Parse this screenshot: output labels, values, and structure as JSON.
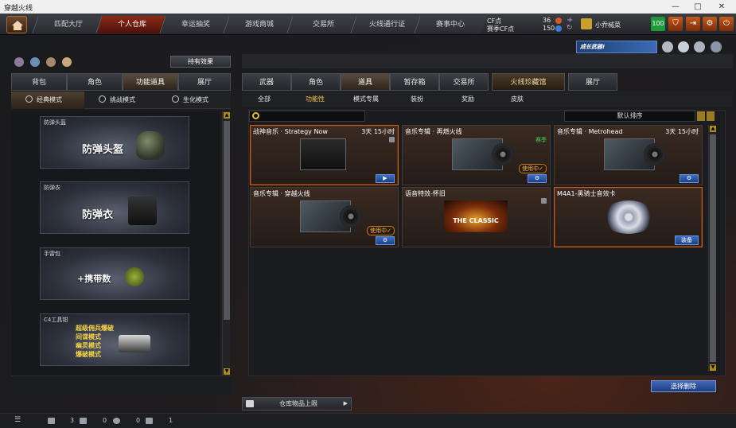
{
  "window": {
    "title": "穿越火线",
    "controls": [
      "—",
      "□",
      "✕"
    ]
  },
  "topnav": {
    "tabs": [
      {
        "label": "匹配大厅",
        "active": false
      },
      {
        "label": "个人仓库",
        "active": true
      },
      {
        "label": "幸运抽奖",
        "active": false
      },
      {
        "label": "游戏商城",
        "active": false
      },
      {
        "label": "交易所",
        "active": false
      },
      {
        "label": "火线通行证",
        "active": false
      },
      {
        "label": "赛事中心",
        "active": false
      }
    ],
    "cf_label": "CF点",
    "cf_value": "36",
    "season_cf_label": "赛季CF点",
    "season_cf_value": "150",
    "username": "小乔械菜",
    "level": "100",
    "colors": {
      "active_tab": "#8e2a17",
      "accent": "#c65a1c"
    }
  },
  "left": {
    "effects_button": "持有效果",
    "tabs": [
      {
        "label": "背包",
        "active": false
      },
      {
        "label": "角色",
        "active": false
      },
      {
        "label": "功能道具",
        "active": true
      },
      {
        "label": "展厅",
        "active": false
      }
    ],
    "modes": [
      {
        "label": "经典模式",
        "active": true
      },
      {
        "label": "挑战模式",
        "active": false
      },
      {
        "label": "生化模式",
        "active": false
      }
    ],
    "cards": [
      {
        "caption": "防弹头盔",
        "title": "防弹头盔"
      },
      {
        "caption": "防弹衣",
        "title": "防弹衣"
      },
      {
        "caption": "手雷包",
        "title": "+携带数"
      },
      {
        "caption": "C4工具钳",
        "lines": [
          "超级佣兵爆破",
          "间谍模式",
          "幽灵模式",
          "爆破模式"
        ]
      }
    ]
  },
  "right": {
    "promo": "成长武器!",
    "tabs": [
      {
        "label": "武器",
        "active": false
      },
      {
        "label": "角色",
        "active": false
      },
      {
        "label": "道具",
        "active": true
      },
      {
        "label": "暂存箱",
        "active": false
      },
      {
        "label": "交易所",
        "active": false
      },
      {
        "label": "火线珍藏馆",
        "active": false
      },
      {
        "label": "展厅",
        "active": false
      }
    ],
    "subtabs": [
      {
        "label": "全部",
        "active": false
      },
      {
        "label": "功能性",
        "active": true
      },
      {
        "label": "模式专属",
        "active": false
      },
      {
        "label": "装扮",
        "active": false
      },
      {
        "label": "奖励",
        "active": false
      },
      {
        "label": "皮肤",
        "active": false
      }
    ],
    "search_placeholder": "",
    "sort_label": "默认排序",
    "items": [
      {
        "name": "战神音乐 · Strategy Now",
        "time": "3天 15小时",
        "selected": true,
        "action": "▶"
      },
      {
        "name": "音乐专辑 · 再燃火线",
        "tag": "赛季",
        "status": "使用中✓",
        "action": "⚙"
      },
      {
        "name": "音乐专辑 · Metrohead",
        "time": "3天 15小时",
        "action": "⚙"
      },
      {
        "name": "音乐专辑 · 穿越火线",
        "status": "使用中✓",
        "action": "⚙"
      },
      {
        "name": "语音特效-怀旧",
        "art_text": "THE CLASSIC"
      },
      {
        "name": "M4A1-黑骑士音效卡",
        "selected": true,
        "action": "装备"
      }
    ],
    "delete_button": "选择删除"
  },
  "footer": {
    "capacity_button": "仓库物品上限",
    "stats": [
      "3",
      "0",
      "0",
      "1"
    ]
  }
}
